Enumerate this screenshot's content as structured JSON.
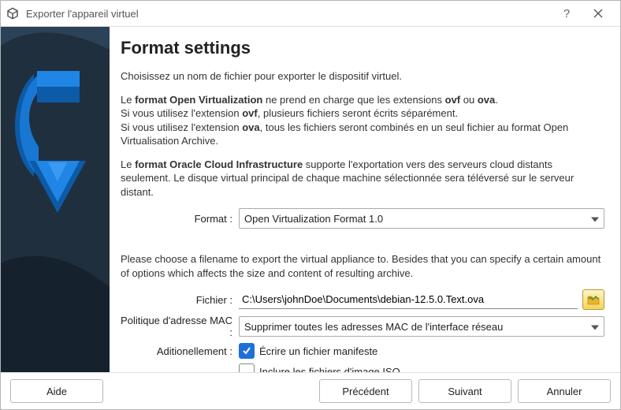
{
  "window": {
    "title": "Exporter l'appareil virtuel"
  },
  "page": {
    "heading": "Format settings",
    "intro": "Choisissez un nom de fichier pour exporter le dispositif virtuel.",
    "p2_a": "Le ",
    "p2_b": "format Open Virtualization",
    "p2_c": " ne prend en charge que les extensions ",
    "p2_d": "ovf",
    "p2_e": " ou ",
    "p2_f": "ova",
    "p2_g": ".",
    "p3_a": "Si vous utilisez l'extension ",
    "p3_b": "ovf",
    "p3_c": ", plusieurs fichiers seront écrits séparément.",
    "p4_a": "Si vous utilisez l'extension ",
    "p4_b": "ova",
    "p4_c": ", tous les fichiers seront combinés en un seul fichier au format Open Virtualisation Archive.",
    "p5_a": "Le ",
    "p5_b": "format Oracle Cloud Infrastructure",
    "p5_c": " supporte l'exportation vers des serveurs cloud distants seulement. Le disque virtual principal de chaque machine sélectionnée sera téléversé sur le serveur distant.",
    "midnote": "Please choose a filename to export the virtual appliance to. Besides that you can specify a certain amount of options which affects the size and content of resulting archive."
  },
  "form": {
    "format_label": "Format :",
    "format_value": "Open Virtualization Format 1.0",
    "file_label": "Fichier :",
    "file_value": "C:\\Users\\johnDoe\\Documents\\debian-12.5.0.Text.ova",
    "mac_label": "Politique d'adresse MAC :",
    "mac_value": "Supprimer toutes les adresses MAC de l'interface réseau",
    "additional_label": "Aditionellement :",
    "manifest_label": "Écrire un fichier manifeste",
    "manifest_checked": true,
    "iso_label": "Inclure les fichiers d'image ISO",
    "iso_checked": false
  },
  "footer": {
    "help": "Aide",
    "back": "Précédent",
    "next": "Suivant",
    "cancel": "Annuler"
  }
}
